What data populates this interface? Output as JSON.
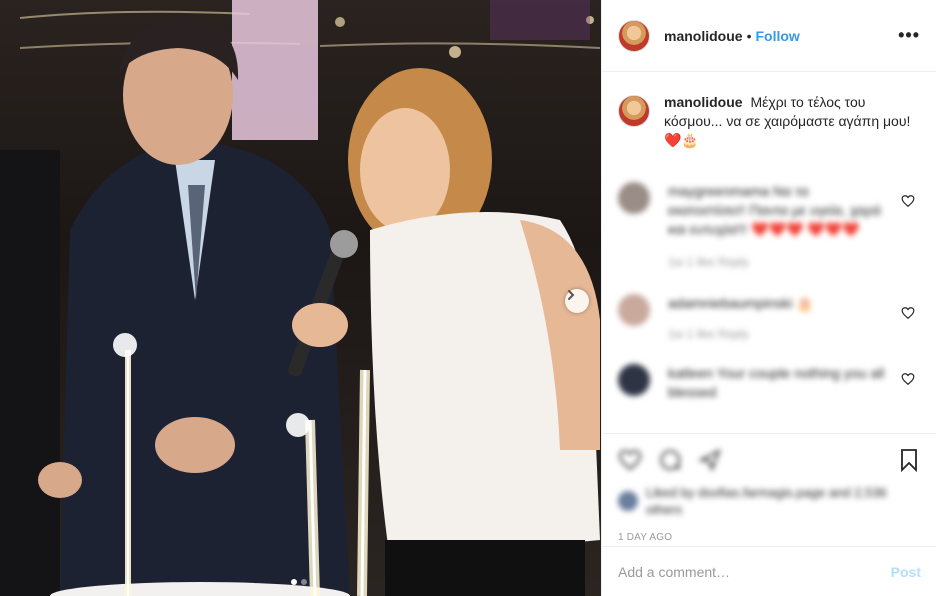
{
  "post": {
    "username": "manolidoue",
    "separator": "•",
    "follow_label": "Follow",
    "more_label": "•••",
    "caption_user": "manolidoue",
    "caption_text": "Μέχρι το τέλος του κόσμου... να σε χαιρόμαστε αγάπη μου! ❤️🎂",
    "photo_description_icon": "party-photo",
    "carousel_index": 1,
    "carousel_total": 2
  },
  "comments": [
    {
      "text": "maygreenmama Να τα εκατοστίσει!! Παντα με υγεία, χαρά και ευτυχία!!! ❤️❤️❤️ ❤️❤️❤️",
      "meta": "1w   1 like   Reply"
    },
    {
      "text": "adamniebaumpinski 🎂",
      "meta": "1w   1 like   Reply"
    },
    {
      "text": "katleen Your couple nothing you all blessed",
      "meta": ""
    }
  ],
  "likes": {
    "text": "Liked by dsofias.farmagis.page and 2,536 others"
  },
  "timestamp": "1 DAY AGO",
  "comment_box": {
    "placeholder": "Add a comment…",
    "post_label": "Post"
  },
  "colors": {
    "accent": "#3897f0",
    "post_disabled": "#b2dffc",
    "muted": "#999999",
    "border": "#efefef"
  }
}
